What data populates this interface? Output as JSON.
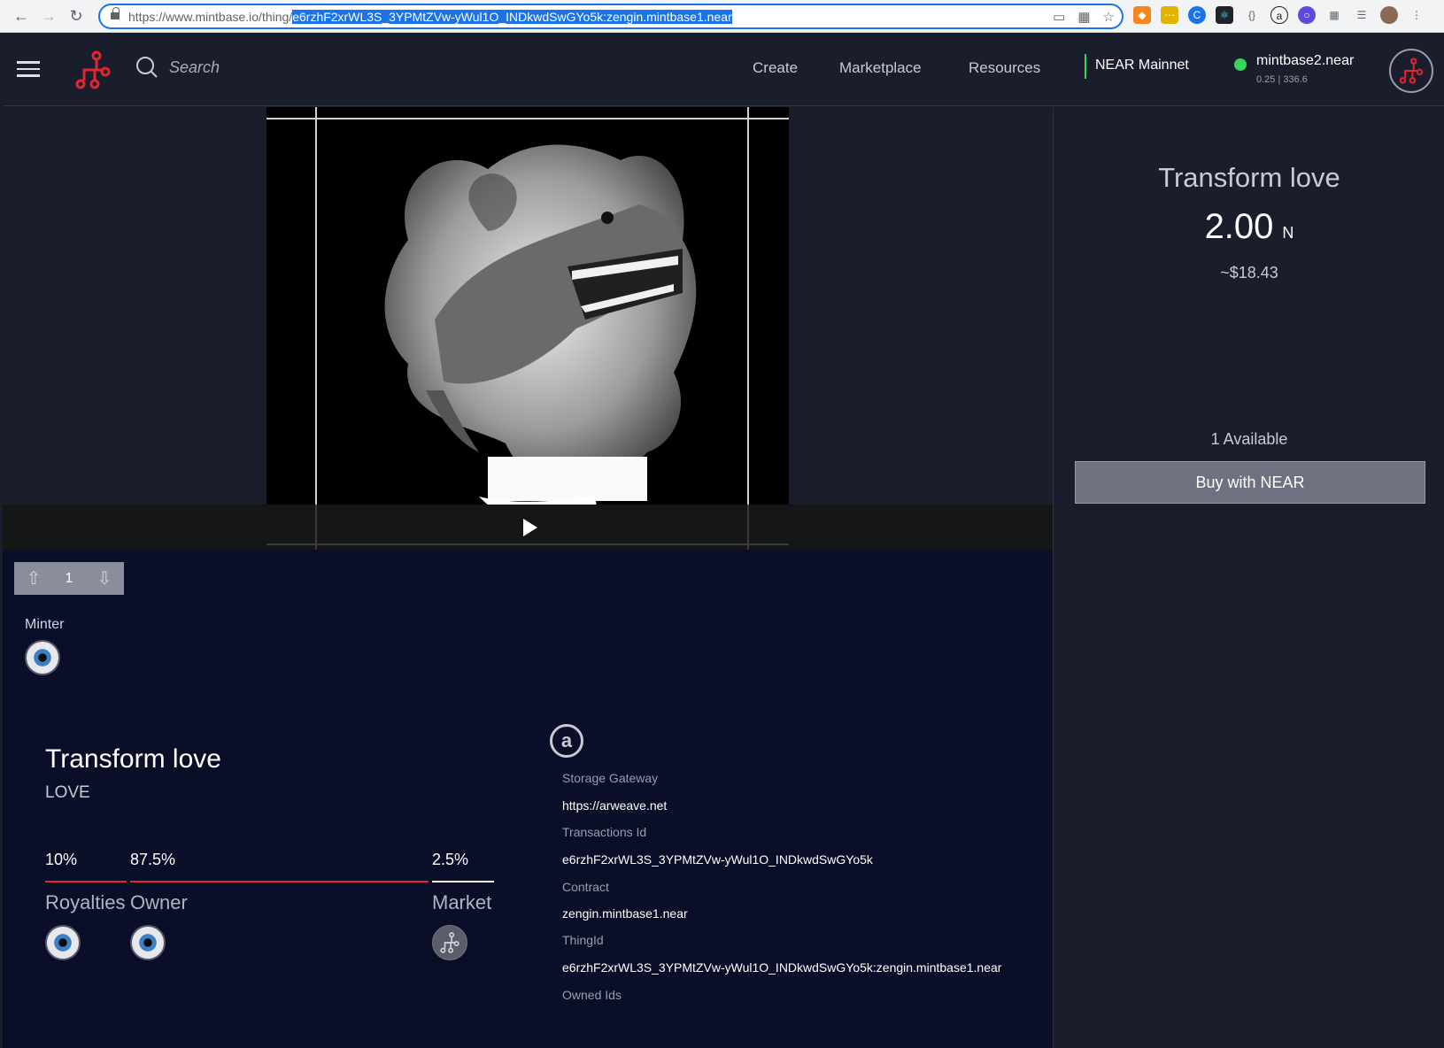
{
  "browser": {
    "url_prefix": "https://www.mintbase.io/",
    "url_path": "thing/",
    "url_selected": "e6rzhF2xrWL3S_3YPMtZVw-yWul1O_INDkwdSwGYo5k:zengin.mintbase1.near"
  },
  "header": {
    "search_placeholder": "Search",
    "nav": [
      "Create",
      "Marketplace",
      "Resources"
    ],
    "network": "NEAR Mainnet",
    "account": "mintbase2.near",
    "balance": "0.25 | 336.6",
    "accent": "#e0262f",
    "network_color": "#3ad35b"
  },
  "stepper": {
    "value": "1"
  },
  "minter": {
    "label": "Minter"
  },
  "thing": {
    "title": "Transform love",
    "symbol": "LOVE"
  },
  "split": {
    "royalties_pct": "10%",
    "owner_pct": "87.5%",
    "market_pct": "2.5%",
    "royalties_label": "Royalties",
    "owner_label": "Owner",
    "market_label": "Market"
  },
  "meta": {
    "storage_gateway_label": "Storage Gateway",
    "storage_gateway": "https://arweave.net",
    "transactions_label": "Transactions Id",
    "transactions_id": "e6rzhF2xrWL3S_3YPMtZVw-yWul1O_INDkwdSwGYo5k",
    "contract_label": "Contract",
    "contract": "zengin.mintbase1.near",
    "thingid_label": "ThingId",
    "thingid": "e6rzhF2xrWL3S_3YPMtZVw-yWul1O_INDkwdSwGYo5k:zengin.mintbase1.near",
    "owned_ids_label": "Owned Ids"
  },
  "sale": {
    "title": "Transform love",
    "price": "2.00",
    "unit": "N",
    "usd": "~$18.43",
    "available": "1 Available",
    "buy_label": "Buy with NEAR"
  }
}
